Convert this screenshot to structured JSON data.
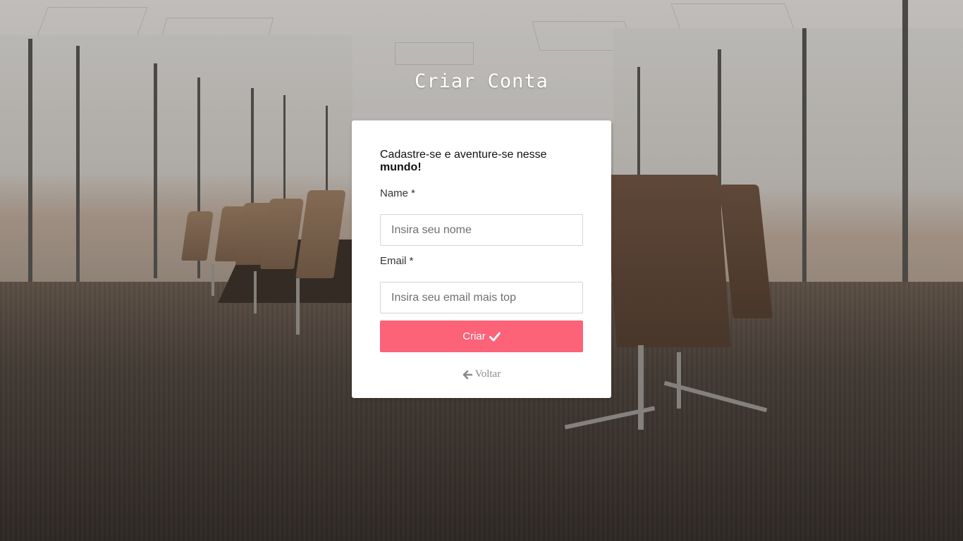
{
  "page": {
    "title": "Criar Conta"
  },
  "form": {
    "subtitle_prefix": "Cadastre-se e aventure-se nesse ",
    "subtitle_bold": "mundo!",
    "name_label": "Name *",
    "name_placeholder": "Insira seu nome",
    "email_label": "Email *",
    "email_placeholder": "Insira seu email mais top",
    "submit_label": "Criar",
    "submit_icon": "check-icon",
    "back_label": "Voltar",
    "back_icon": "arrow-left-icon"
  },
  "colors": {
    "accent": "#fc6278",
    "card_bg": "#ffffff",
    "back_link": "#8a8a8a"
  }
}
